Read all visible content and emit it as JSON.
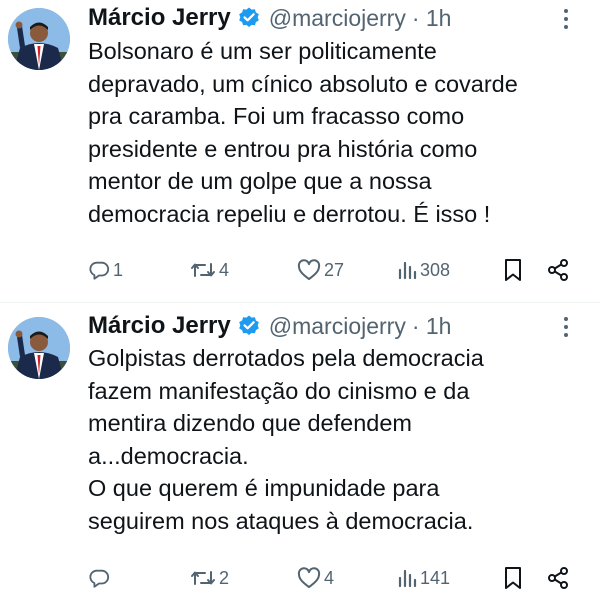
{
  "tweets": [
    {
      "author": {
        "name": "Márcio Jerry",
        "handle": "@marciojerry",
        "time": "· 1h",
        "verified": true,
        "avatar": "avatar"
      },
      "text_lines": [
        "Bolsonaro é um ser politicamente",
        "depravado, um cínico absoluto e covarde",
        "pra caramba. Foi um fracasso como",
        "presidente e entrou pra história como",
        "mentor de um golpe que a nossa",
        "democracia repeliu e derrotou. É isso !"
      ],
      "stats": {
        "replies": "1",
        "reposts": "4",
        "likes": "27",
        "views": "308"
      }
    },
    {
      "author": {
        "name": "Márcio Jerry",
        "handle": "@marciojerry",
        "time": "· 1h",
        "verified": true,
        "avatar": "avatar"
      },
      "text_lines": [
        "Golpistas derrotados pela democracia",
        "fazem manifestação do cinismo e da",
        "mentira dizendo que defendem",
        "a...democracia.",
        "O que querem é impunidade para",
        "seguirem nos ataques à democracia."
      ],
      "stats": {
        "replies": "",
        "reposts": "2",
        "likes": "4",
        "views": "141"
      }
    }
  ],
  "colors": {
    "text": "#0f1419",
    "secondary": "#536471",
    "verified": "#1d9bf0",
    "divider": "#eff3f4"
  },
  "icons": [
    "reply-icon",
    "repost-icon",
    "like-icon",
    "views-icon",
    "bookmark-icon",
    "share-icon",
    "more-icon",
    "verified-badge-icon"
  ]
}
